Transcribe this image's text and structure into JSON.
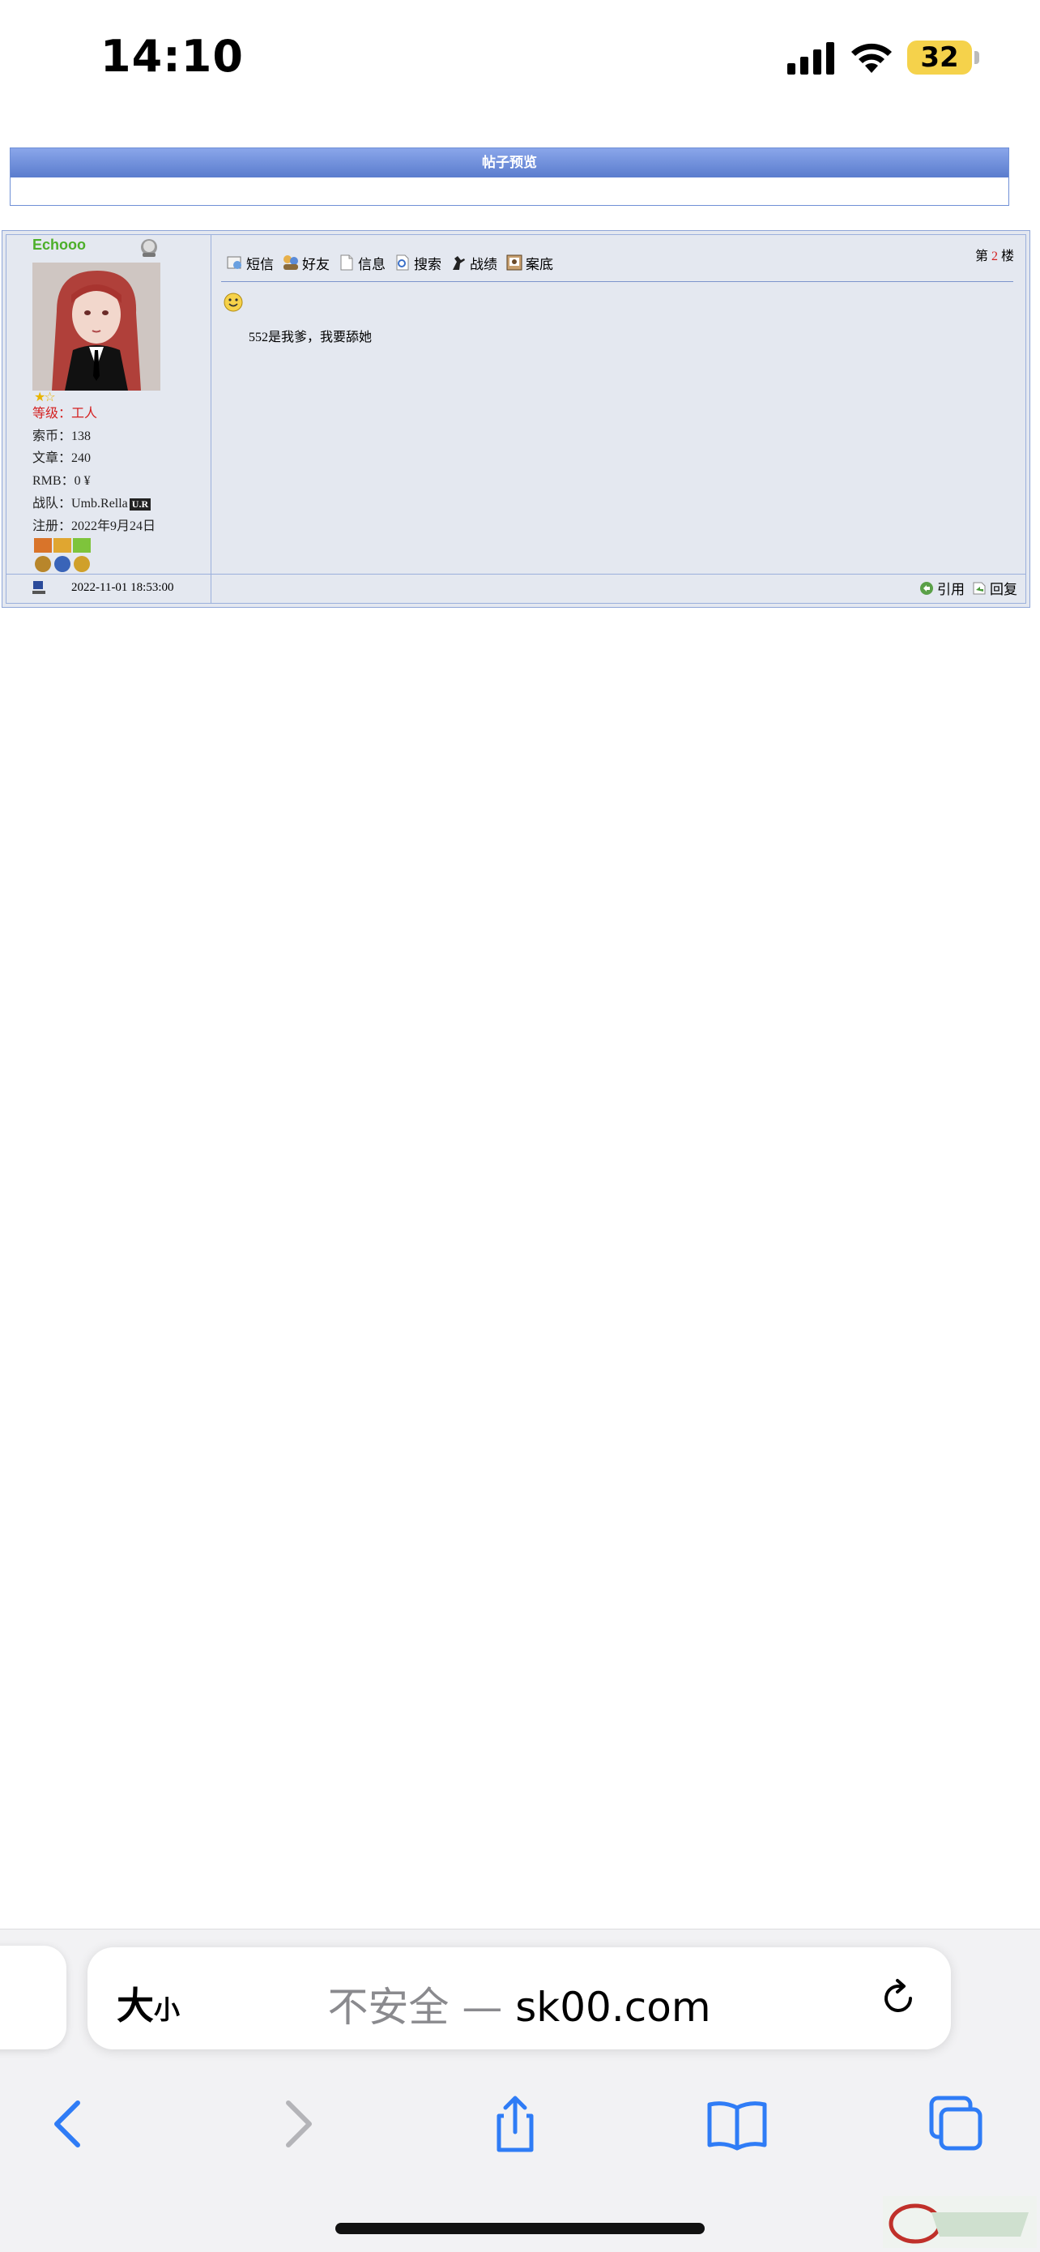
{
  "status_bar": {
    "time": "14:10",
    "battery": "32"
  },
  "preview": {
    "title": "帖子预览"
  },
  "post": {
    "username": "Echooo",
    "level_label": "等级：",
    "level_value": "工人",
    "coins_label": "索币：",
    "coins_value": "138",
    "articles_label": "文章：",
    "articles_value": "240",
    "rmb_label": "RMB：",
    "rmb_value": "0 ¥",
    "team_label": "战队：",
    "team_value": "Umb.Rella",
    "team_tag": "U.R",
    "register_label": "注册：",
    "register_value": "2022年9月24日",
    "toolbar": [
      "短信",
      "好友",
      "信息",
      "搜索",
      "战绩",
      "案底"
    ],
    "floor_prefix": "第",
    "floor_number": "2",
    "floor_suffix": "楼",
    "message": "552是我爹，我要舔她",
    "post_time": "2022-11-01 18:53:00",
    "actions": [
      "引用",
      "回复"
    ]
  },
  "safari": {
    "text_size": "大",
    "text_size_small": "小",
    "url_insecure": "不安全 — ",
    "url_domain": "sk00.com"
  },
  "colors": {
    "header_blue": "#5a7ccd",
    "post_bg": "#e4e8f0",
    "username_green": "#4caf2a",
    "safari_blue": "#2f7cf6"
  }
}
